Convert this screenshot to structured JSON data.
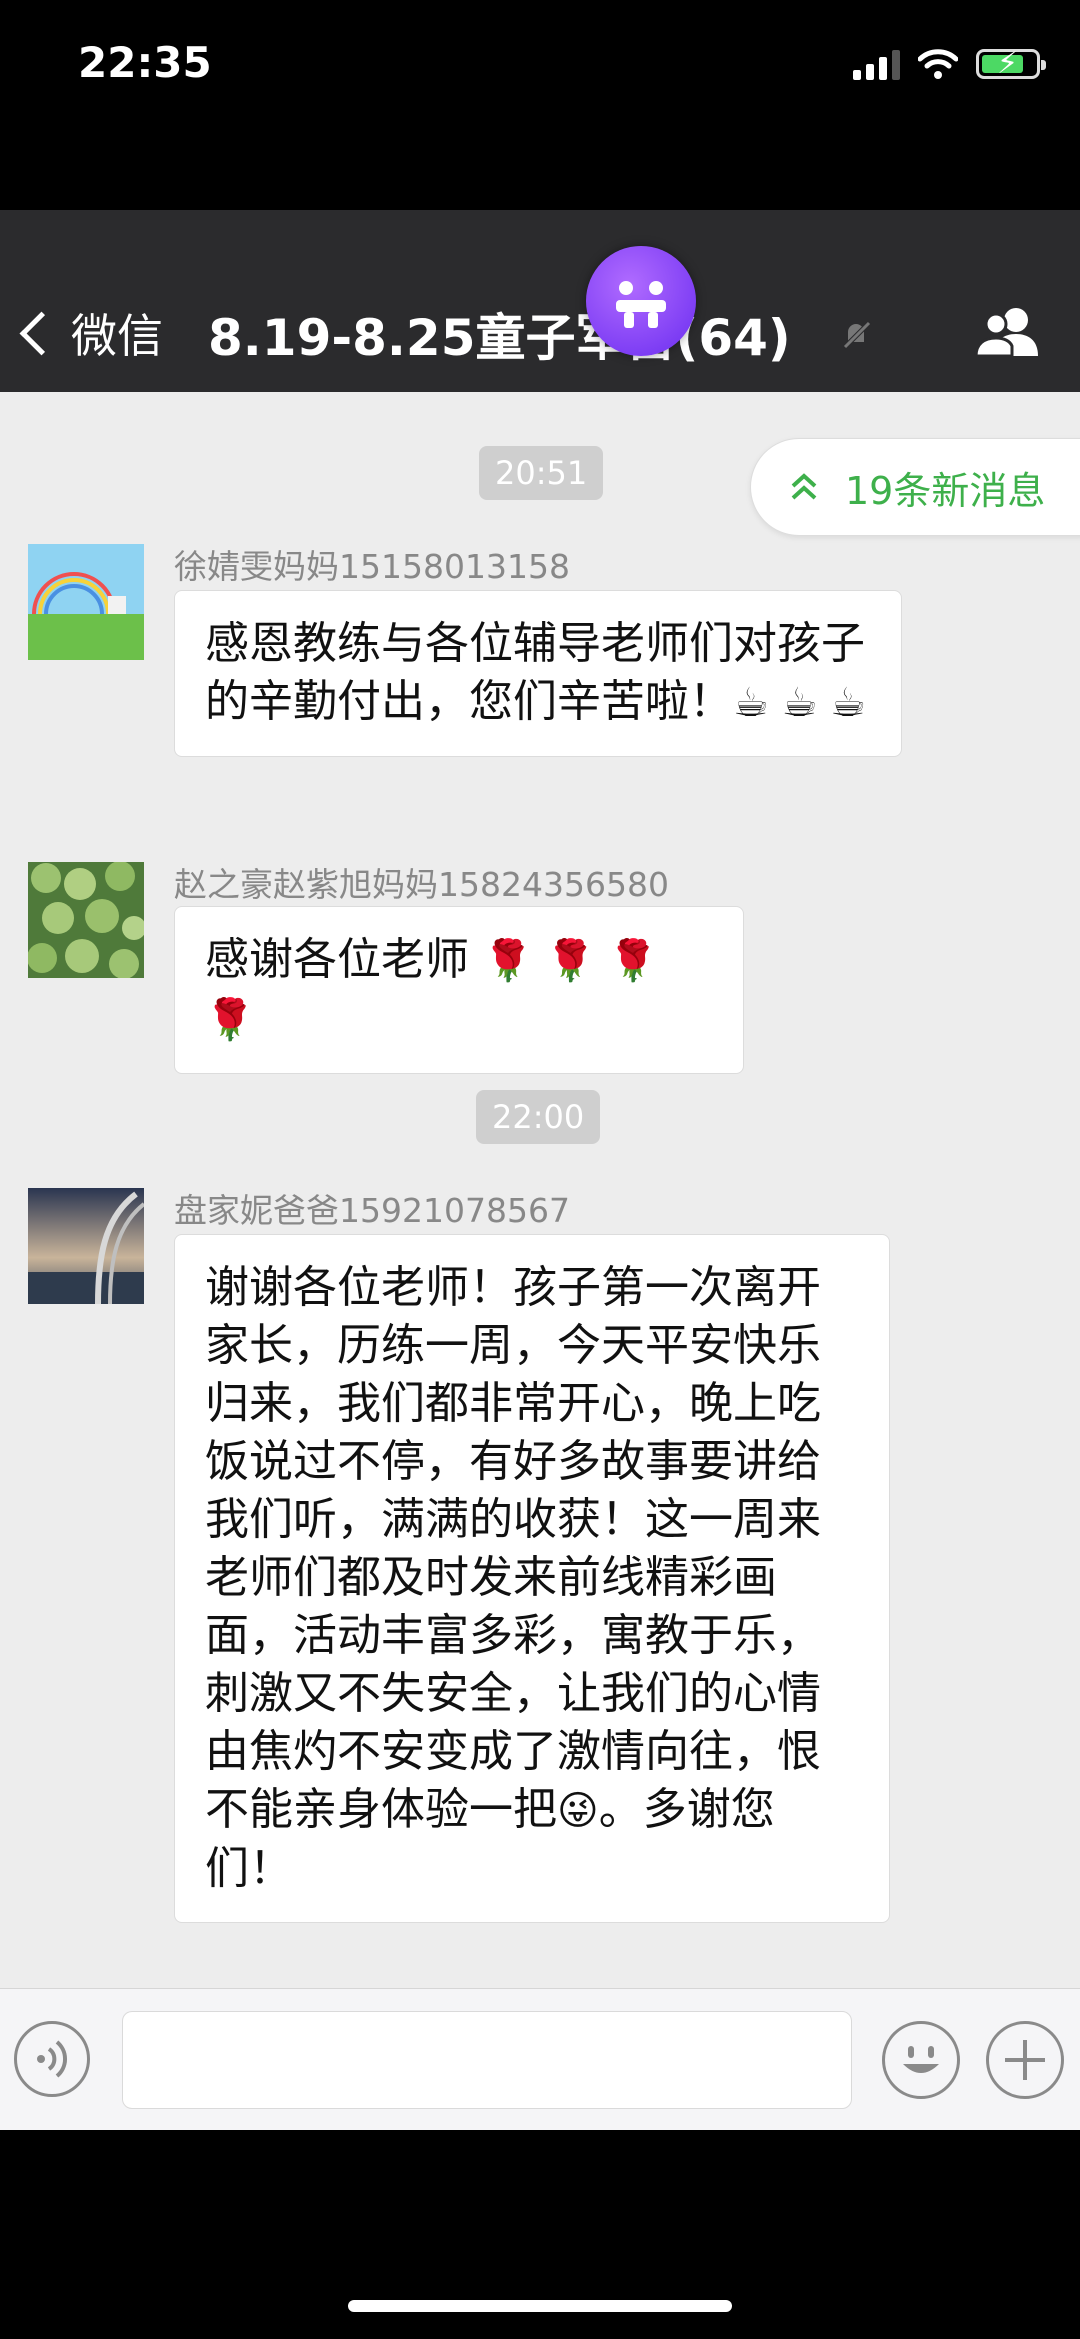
{
  "status_bar": {
    "time": "22:35"
  },
  "nav": {
    "back_label": "微信",
    "title": "8.19-8.25童子军营(64)"
  },
  "new_messages": {
    "label": "19条新消息"
  },
  "timestamps": [
    "20:51",
    "22:00"
  ],
  "messages": [
    {
      "sender": "徐婧雯妈妈15158013158",
      "text": "感恩教练与各位辅导老师们对孩子的辛勤付出，您们辛苦啦！",
      "emoji": "☕ ☕ ☕"
    },
    {
      "sender": "赵之豪赵紫旭妈妈15824356580",
      "text": "感谢各位老师",
      "emoji": "🌹 🌹 🌹 🌹"
    },
    {
      "sender": "盘家妮爸爸15921078567",
      "text_before": "谢谢各位老师！孩子第一次离开家长，历练一周，今天平安快乐归来，我们都非常开心，晚上吃饭说过不停，有好多故事要讲给我们听，满满的收获！这一周来老师们都及时发来前线精彩画面，活动丰富多彩，寓教于乐，刺激又不失安全，让我们的心情由焦灼不安变成了激情向往，恨不能亲身体验一把",
      "emoji": "😜",
      "text_after": "。多谢您们！"
    }
  ],
  "icons": {
    "back": "chevron-left-icon",
    "mute": "bell-slash-icon",
    "members": "group-icon",
    "new_messages": "double-chevron-up-icon",
    "voice": "voice-icon",
    "emoji": "smiley-icon",
    "plus": "plus-icon"
  },
  "colors": {
    "nav_bg": "#2b2b2d",
    "chat_bg": "#ededed",
    "accent_green": "#3eb04b"
  }
}
